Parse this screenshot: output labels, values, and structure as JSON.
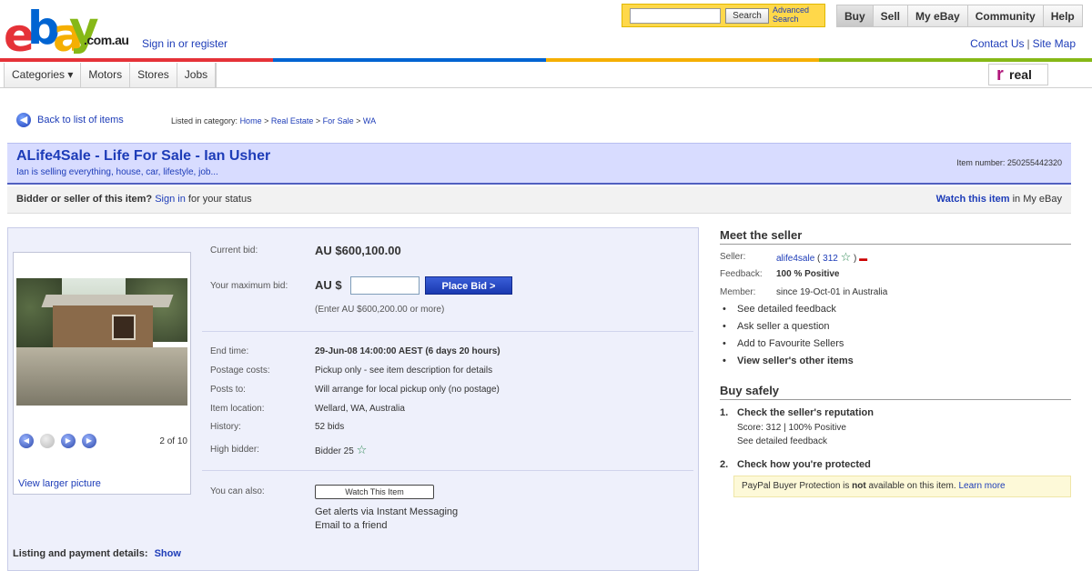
{
  "header": {
    "logo_text": "ebay",
    "logo_domain": ".com.au",
    "signin_link": "Sign in or register",
    "search_button": "Search",
    "advanced_search": "Advanced Search",
    "nav": [
      "Buy",
      "Sell",
      "My eBay",
      "Community",
      "Help"
    ],
    "contact_link": "Contact Us",
    "sitemap_link": "Site Map",
    "categories": [
      "Categories ▾",
      "Motors",
      "Stores",
      "Jobs"
    ],
    "partner_logo": "real"
  },
  "colors": {
    "brand_red": "#e53238",
    "brand_blue": "#0064d2",
    "brand_yellow": "#f5af02",
    "brand_green": "#86b817",
    "title_band": "#d8dcff",
    "link": "#1d3cb8"
  },
  "back_row": {
    "back_link": "Back to list of items",
    "breadcrumb_prefix": "Listed in category:",
    "breadcrumb": [
      "Home",
      "Real Estate",
      "For Sale",
      "WA"
    ]
  },
  "item": {
    "title": "ALife4Sale - Life For Sale - Ian Usher",
    "subtitle": "Ian is selling everything, house, car, lifestyle, job...",
    "item_number_label": "Item number:",
    "item_number": "250255442320"
  },
  "status": {
    "bidder_bold": "Bidder or seller of this item?",
    "sign_in": "Sign in",
    "bidder_tail": "for your status",
    "watch_bold": "Watch this item",
    "watch_tail": "in My eBay"
  },
  "bid": {
    "current_label": "Current bid:",
    "current_value": "AU $600,100.00",
    "max_label": "Your maximum bid:",
    "currency_prefix": "AU $",
    "place_bid": "Place Bid >",
    "hint": "(Enter AU $600,200.00 or more)"
  },
  "details": [
    {
      "label": "End time:",
      "value": "29-Jun-08 14:00:00 AEST (6 days 20 hours)",
      "bold": true
    },
    {
      "label": "Postage costs:",
      "value": "Pickup only - see item description for details",
      "bold": false
    },
    {
      "label": "Posts to:",
      "value": "Will arrange for local pickup only (no postage)",
      "bold": false
    },
    {
      "label": "Item location:",
      "value": "Wellard, WA, Australia",
      "bold": false
    },
    {
      "label": "History:",
      "value": "52 bids",
      "bold": false
    },
    {
      "label": "High bidder:",
      "value": "Bidder 25",
      "bold": false
    }
  ],
  "actions": {
    "label": "You can also:",
    "watch_button": "Watch This Item",
    "alert_link": "Get alerts via Instant Messaging",
    "email_link": "Email to a friend"
  },
  "photo": {
    "count": "2 of 10",
    "view_larger": "View larger picture"
  },
  "listing_details": "Listing and payment details:",
  "listing_show": "Show",
  "seller": {
    "heading": "Meet the seller",
    "seller_label": "Seller:",
    "seller_name": "alife4sale",
    "seller_score": "312",
    "feedback_label": "Feedback:",
    "feedback_value": "100 % Positive",
    "member_label": "Member:",
    "member_value": "since 19-Oct-01 in Australia",
    "links": [
      "See detailed feedback",
      "Ask seller a question",
      "Add to Favourite Sellers",
      "View seller's other items"
    ]
  },
  "buy_safely": {
    "heading": "Buy safely",
    "step1_num": "1.",
    "step1_title": "Check the seller's reputation",
    "step1_score": "Score: 312 | 100% Positive",
    "step1_link": "See detailed feedback",
    "step2_num": "2.",
    "step2_title": "Check how you're protected",
    "paypal_pre": "PayPal Buyer Protection is",
    "paypal_bold": "not",
    "paypal_post": "available on this item.",
    "learn_more": "Learn more"
  }
}
